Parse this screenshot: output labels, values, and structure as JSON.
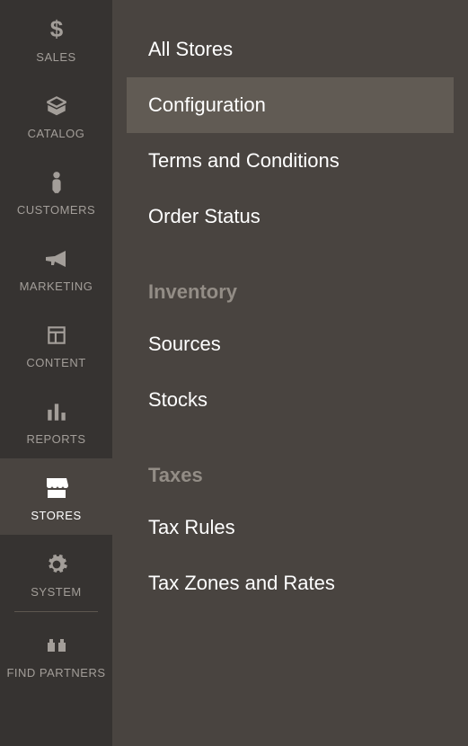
{
  "sidebar": {
    "items": [
      {
        "label": "SALES",
        "icon": "dollar"
      },
      {
        "label": "CATALOG",
        "icon": "box"
      },
      {
        "label": "CUSTOMERS",
        "icon": "person"
      },
      {
        "label": "MARKETING",
        "icon": "megaphone"
      },
      {
        "label": "CONTENT",
        "icon": "layout"
      },
      {
        "label": "REPORTS",
        "icon": "bars"
      },
      {
        "label": "STORES",
        "icon": "storefront"
      },
      {
        "label": "SYSTEM",
        "icon": "gear"
      },
      {
        "label": "FIND PARTNERS",
        "icon": "blocks"
      }
    ]
  },
  "submenu": {
    "settings_items": [
      {
        "label": "All Stores"
      },
      {
        "label": "Configuration"
      },
      {
        "label": "Terms and Conditions"
      },
      {
        "label": "Order Status"
      }
    ],
    "inventory_header": "Inventory",
    "inventory_items": [
      {
        "label": "Sources"
      },
      {
        "label": "Stocks"
      }
    ],
    "taxes_header": "Taxes",
    "taxes_items": [
      {
        "label": "Tax Rules"
      },
      {
        "label": "Tax Zones and Rates"
      }
    ]
  }
}
